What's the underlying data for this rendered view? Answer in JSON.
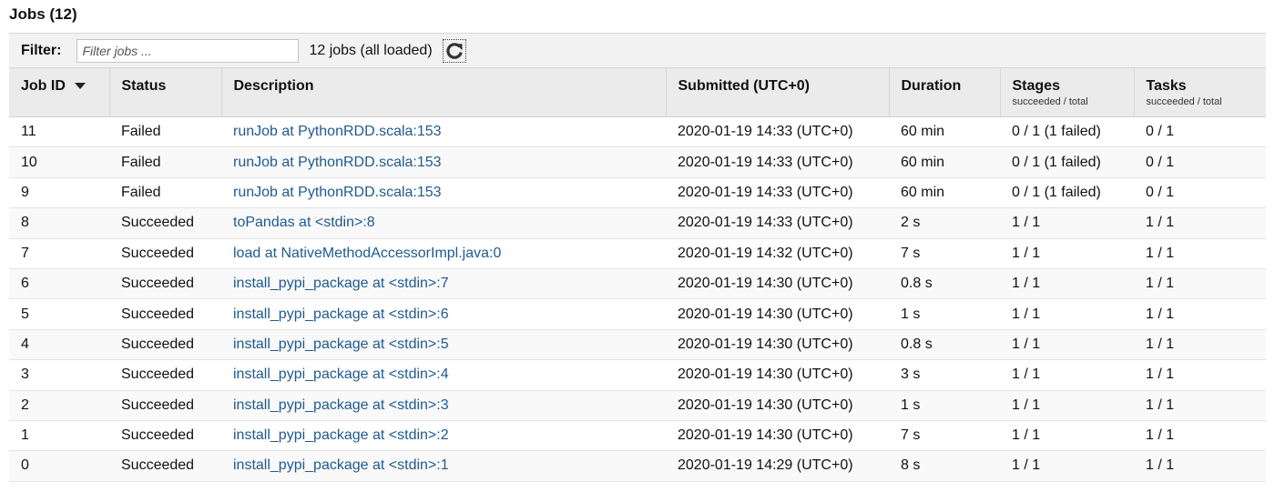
{
  "page": {
    "title": "Jobs (12)"
  },
  "filter": {
    "label": "Filter:",
    "placeholder": "Filter jobs ...",
    "value": "",
    "count_text": "12 jobs (all loaded)"
  },
  "table": {
    "headers": {
      "job_id": "Job ID",
      "status": "Status",
      "description": "Description",
      "submitted": "Submitted (UTC+0)",
      "duration": "Duration",
      "stages": "Stages",
      "stages_sub": "succeeded / total",
      "tasks": "Tasks",
      "tasks_sub": "succeeded / total"
    },
    "sort": {
      "column": "job_id",
      "direction": "descending"
    },
    "rows": [
      {
        "job_id": "11",
        "status": "Failed",
        "description": "runJob at PythonRDD.scala:153",
        "submitted": "2020-01-19 14:33 (UTC+0)",
        "duration": "60 min",
        "stages": "0 / 1 (1 failed)",
        "tasks": "0 / 1"
      },
      {
        "job_id": "10",
        "status": "Failed",
        "description": "runJob at PythonRDD.scala:153",
        "submitted": "2020-01-19 14:33 (UTC+0)",
        "duration": "60 min",
        "stages": "0 / 1 (1 failed)",
        "tasks": "0 / 1"
      },
      {
        "job_id": "9",
        "status": "Failed",
        "description": "runJob at PythonRDD.scala:153",
        "submitted": "2020-01-19 14:33 (UTC+0)",
        "duration": "60 min",
        "stages": "0 / 1 (1 failed)",
        "tasks": "0 / 1"
      },
      {
        "job_id": "8",
        "status": "Succeeded",
        "description": "toPandas at <stdin>:8",
        "submitted": "2020-01-19 14:33 (UTC+0)",
        "duration": "2 s",
        "stages": "1 / 1",
        "tasks": "1 / 1"
      },
      {
        "job_id": "7",
        "status": "Succeeded",
        "description": "load at NativeMethodAccessorImpl.java:0",
        "submitted": "2020-01-19 14:32 (UTC+0)",
        "duration": "7 s",
        "stages": "1 / 1",
        "tasks": "1 / 1"
      },
      {
        "job_id": "6",
        "status": "Succeeded",
        "description": "install_pypi_package at <stdin>:7",
        "submitted": "2020-01-19 14:30 (UTC+0)",
        "duration": "0.8 s",
        "stages": "1 / 1",
        "tasks": "1 / 1"
      },
      {
        "job_id": "5",
        "status": "Succeeded",
        "description": "install_pypi_package at <stdin>:6",
        "submitted": "2020-01-19 14:30 (UTC+0)",
        "duration": "1 s",
        "stages": "1 / 1",
        "tasks": "1 / 1"
      },
      {
        "job_id": "4",
        "status": "Succeeded",
        "description": "install_pypi_package at <stdin>:5",
        "submitted": "2020-01-19 14:30 (UTC+0)",
        "duration": "0.8 s",
        "stages": "1 / 1",
        "tasks": "1 / 1"
      },
      {
        "job_id": "3",
        "status": "Succeeded",
        "description": "install_pypi_package at <stdin>:4",
        "submitted": "2020-01-19 14:30 (UTC+0)",
        "duration": "3 s",
        "stages": "1 / 1",
        "tasks": "1 / 1"
      },
      {
        "job_id": "2",
        "status": "Succeeded",
        "description": "install_pypi_package at <stdin>:3",
        "submitted": "2020-01-19 14:30 (UTC+0)",
        "duration": "1 s",
        "stages": "1 / 1",
        "tasks": "1 / 1"
      },
      {
        "job_id": "1",
        "status": "Succeeded",
        "description": "install_pypi_package at <stdin>:2",
        "submitted": "2020-01-19 14:30 (UTC+0)",
        "duration": "7 s",
        "stages": "1 / 1",
        "tasks": "1 / 1"
      },
      {
        "job_id": "0",
        "status": "Succeeded",
        "description": "install_pypi_package at <stdin>:1",
        "submitted": "2020-01-19 14:29 (UTC+0)",
        "duration": "8 s",
        "stages": "1 / 1",
        "tasks": "1 / 1"
      }
    ]
  },
  "icons": {
    "refresh": "refresh-icon",
    "sort": "sort-descending-icon"
  }
}
